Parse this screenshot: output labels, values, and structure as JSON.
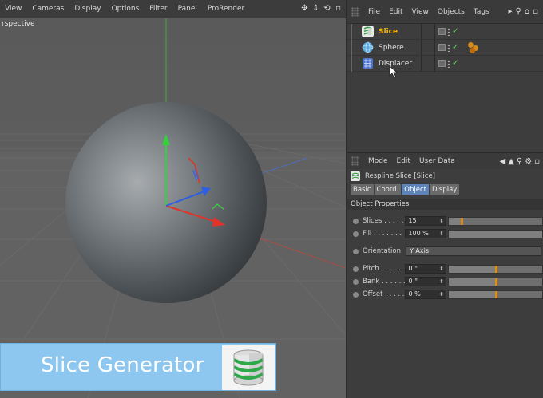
{
  "viewport": {
    "menu": [
      "View",
      "Cameras",
      "Display",
      "Options",
      "Filter",
      "Panel",
      "ProRender"
    ],
    "label": "rspective"
  },
  "object_manager": {
    "menu": [
      "File",
      "Edit",
      "View",
      "Objects",
      "Tags"
    ],
    "objects": [
      {
        "name": "Slice",
        "selected": true,
        "icon": "slice-generator-icon",
        "color": "#ffb000"
      },
      {
        "name": "Sphere",
        "selected": false,
        "icon": "sphere-icon"
      },
      {
        "name": "Displacer",
        "selected": false,
        "icon": "displacer-deformer-icon"
      }
    ]
  },
  "attribute_manager": {
    "menu": [
      "Mode",
      "Edit",
      "User Data"
    ],
    "title": "Respline Slice [Slice]",
    "tabs": [
      "Basic",
      "Coord.",
      "Object",
      "Display"
    ],
    "active_tab": "Object",
    "section": "Object Properties",
    "props": {
      "slices": {
        "label": "Slices . . . . .",
        "value": "15",
        "level": 0.14
      },
      "fill": {
        "label": "Fill . . . . . . .",
        "value": "100 %",
        "level": 1.0
      },
      "orientation": {
        "label": "Orientation",
        "value": "Y Axis"
      },
      "pitch": {
        "label": "Pitch . . . . .",
        "value": "0 °",
        "level": 0.5
      },
      "bank": {
        "label": "Bank . . . . . .",
        "value": "0 °",
        "level": 0.5
      },
      "offset": {
        "label": "Offset . . . . .",
        "value": "0 %",
        "level": 0.5
      }
    }
  },
  "banner": {
    "text": "Slice Generator"
  },
  "colors": {
    "accent": "#ffb000",
    "banner": "#8dc7ef",
    "tab_active": "#5c84b8",
    "check": "#5fd35f"
  }
}
